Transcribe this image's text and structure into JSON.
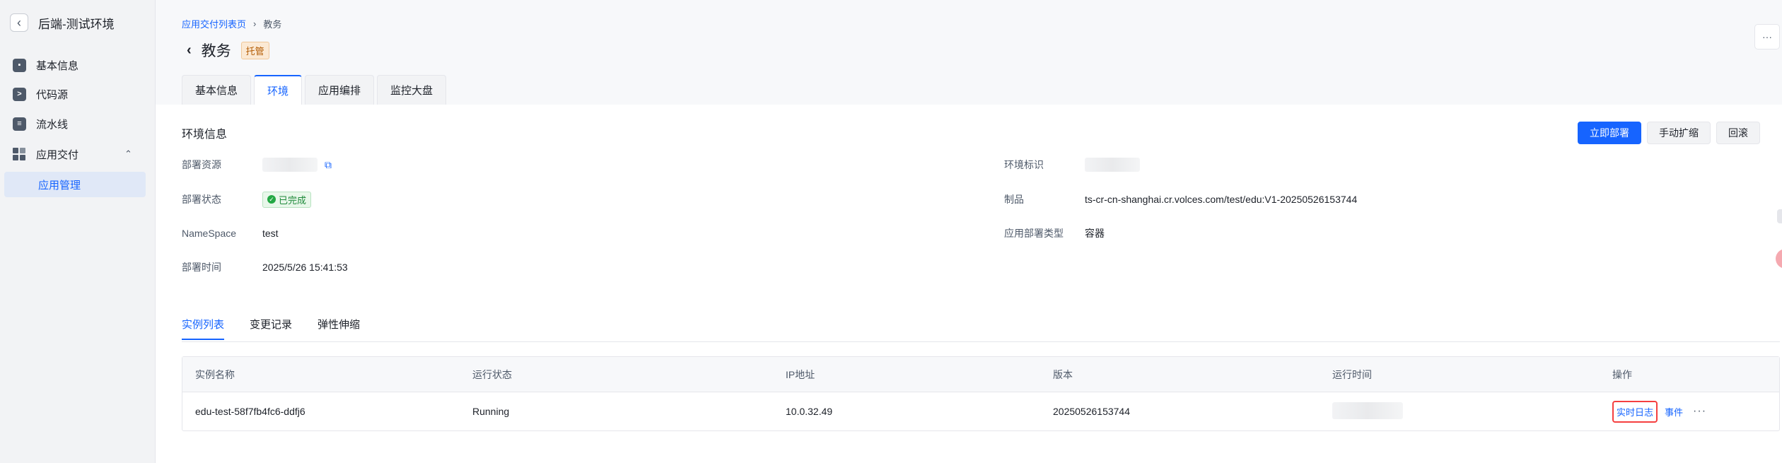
{
  "sidebar": {
    "title": "后端-测试环境",
    "items": [
      {
        "label": "基本信息",
        "icon": "user-card-icon"
      },
      {
        "label": "代码源",
        "icon": "code-icon"
      },
      {
        "label": "流水线",
        "icon": "pipeline-icon"
      },
      {
        "label": "应用交付",
        "icon": "grid-icon"
      }
    ],
    "sub_active": "应用管理"
  },
  "breadcrumb": {
    "parent": "应用交付列表页",
    "current": "教务"
  },
  "header": {
    "title": "教务",
    "tag": "托管",
    "more": "···"
  },
  "tabs": [
    "基本信息",
    "环境",
    "应用编排",
    "监控大盘"
  ],
  "active_tab": "环境",
  "env": {
    "section_title": "环境信息",
    "buttons": {
      "deploy": "立即部署",
      "scale": "手动扩缩",
      "rollback": "回滚"
    },
    "labels": {
      "resource": "部署资源",
      "status": "部署状态",
      "namespace": "NameSpace",
      "time": "部署时间",
      "env_id": "环境标识",
      "artifact": "制品",
      "deploy_type": "应用部署类型"
    },
    "values": {
      "status": "已完成",
      "namespace": "test",
      "time": "2025/5/26 15:41:53",
      "artifact": "ts-cr-cn-shanghai.cr.volces.com/test/edu:V1-20250526153744",
      "deploy_type": "容器"
    }
  },
  "subtabs": [
    "实例列表",
    "变更记录",
    "弹性伸缩"
  ],
  "table": {
    "headers": [
      "实例名称",
      "运行状态",
      "IP地址",
      "版本",
      "运行时间",
      "操作"
    ],
    "row": {
      "name": "edu-test-58f7fb4fc6-ddfj6",
      "status": "Running",
      "ip": "10.0.32.49",
      "version": "20250526153744",
      "op_log": "实时日志",
      "op_event": "事件",
      "op_more": "···"
    }
  },
  "colors": {
    "primary": "#1664ff",
    "highlight": "#f53f3f",
    "success": "#23a844"
  }
}
